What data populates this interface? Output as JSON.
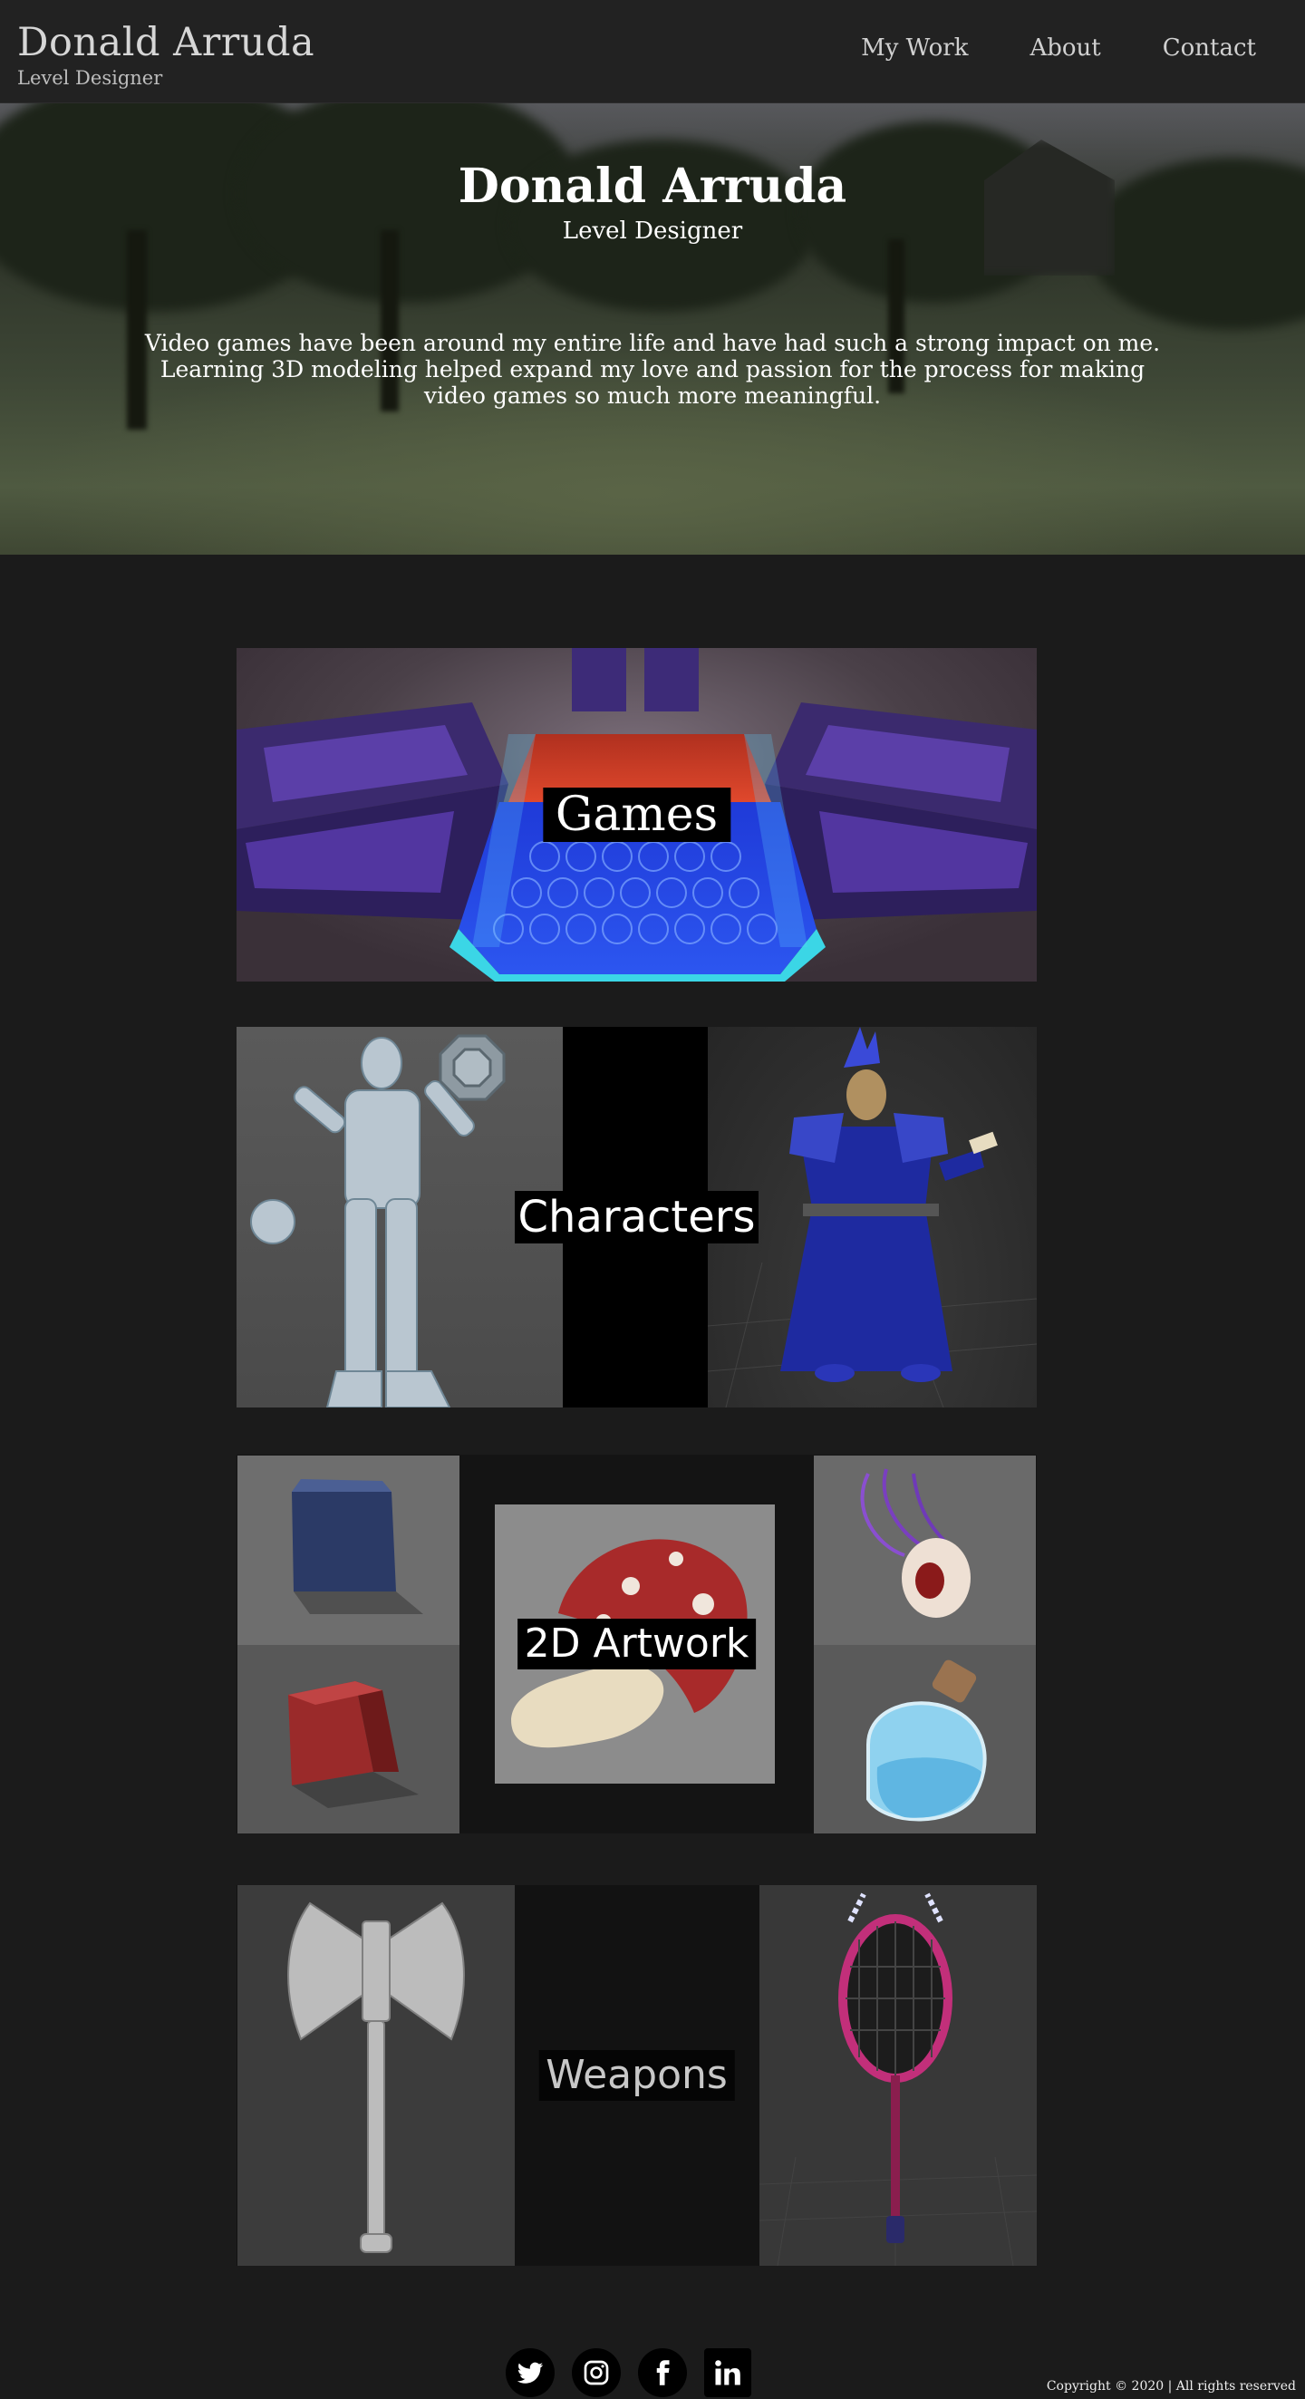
{
  "header": {
    "name": "Donald Arruda",
    "role": "Level Designer",
    "nav": [
      {
        "label": "My Work"
      },
      {
        "label": "About"
      },
      {
        "label": "Contact"
      }
    ]
  },
  "hero": {
    "title": "Donald Arruda",
    "subtitle": "Level Designer",
    "blurb": "Video games have been around my entire life and have had such a strong impact on me. Learning 3D modeling helped expand my love and passion for the process for making video games so much more meaningful."
  },
  "portfolio": [
    {
      "label": "Games"
    },
    {
      "label": "Characters"
    },
    {
      "label": "2D Artwork"
    },
    {
      "label": "Weapons"
    }
  ],
  "footer": {
    "social": [
      {
        "icon": "twitter-icon"
      },
      {
        "icon": "instagram-icon"
      },
      {
        "icon": "facebook-icon"
      },
      {
        "icon": "linkedin-icon"
      }
    ],
    "copyright": "Copyright © 2020 | All rights reserved"
  },
  "colors": {
    "background": "#1b1b1b",
    "header": "#222222",
    "label_bg": "#000000",
    "text": "#ffffff"
  }
}
